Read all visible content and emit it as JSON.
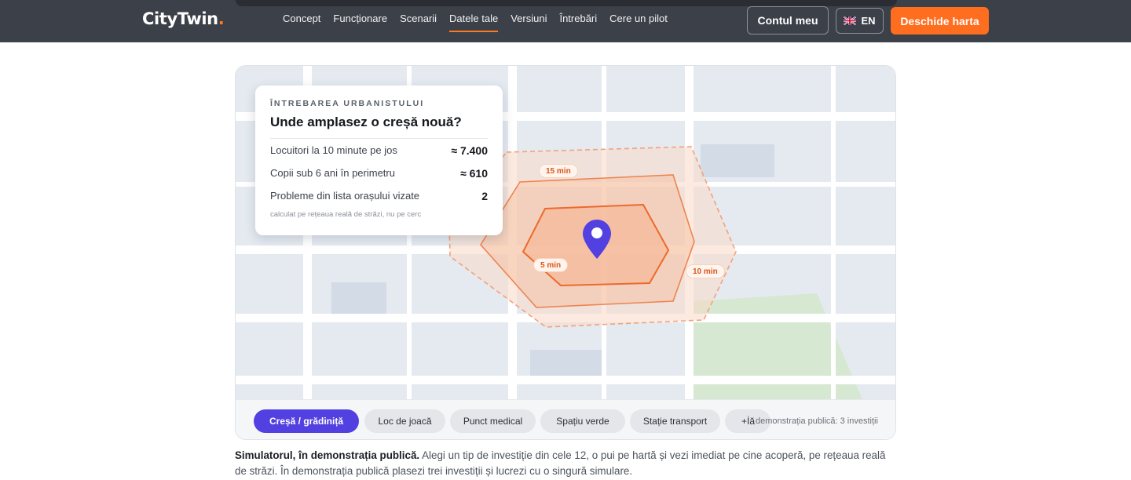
{
  "brand": {
    "name": "CityTwin",
    "dot": ".",
    "accent": "#ff7a1f"
  },
  "nav": {
    "items": [
      {
        "label": "Concept"
      },
      {
        "label": "Funcționare"
      },
      {
        "label": "Scenarii"
      },
      {
        "label": "Datele tale",
        "active": true
      },
      {
        "label": "Versiuni"
      },
      {
        "label": "Întrebări"
      },
      {
        "label": "Cere un pilot"
      }
    ]
  },
  "header": {
    "account_label": "Contul meu",
    "lang_label": "EN",
    "lang_icon": "uk-flag-icon",
    "open_map_label": "Deschide harta"
  },
  "info_card": {
    "eyebrow": "Întrebarea urbanistului",
    "question": "Unde amplasez o creșă nouă?",
    "rows": [
      {
        "label": "Locuitori la 10 minute pe jos",
        "value": "≈ 7.400"
      },
      {
        "label": "Copii sub 6 ani în perimetru",
        "value": "≈ 610"
      },
      {
        "label": "Probleme din lista orașului vizate",
        "value": "2"
      }
    ],
    "note": "calculat pe rețeaua reală de străzi, nu pe cerc"
  },
  "isochrones": {
    "labels": {
      "outer": "15 min",
      "middle": "10 min",
      "inner": "5 min"
    },
    "color": "#f07a3a"
  },
  "categories": {
    "items": [
      {
        "label": "Creșă / grădiniță",
        "active": true
      },
      {
        "label": "Loc de joacă"
      },
      {
        "label": "Punct medical"
      },
      {
        "label": "Spațiu verde"
      },
      {
        "label": "Stație transport"
      },
      {
        "label": "+İă"
      }
    ],
    "active_color": "#5340e0",
    "demo_note": "demonstrația publică: 3 investiții"
  },
  "caption": {
    "lead": "Simulatorul, în demonstrația publică.",
    "text": " Alegi un tip de investiție din cele 12, o pui pe hartă și vezi imediat pe cine acoperă, pe rețeaua reală de străzi. În demonstrația publică plasezi trei investiții și lucrezi cu o singură simulare."
  }
}
